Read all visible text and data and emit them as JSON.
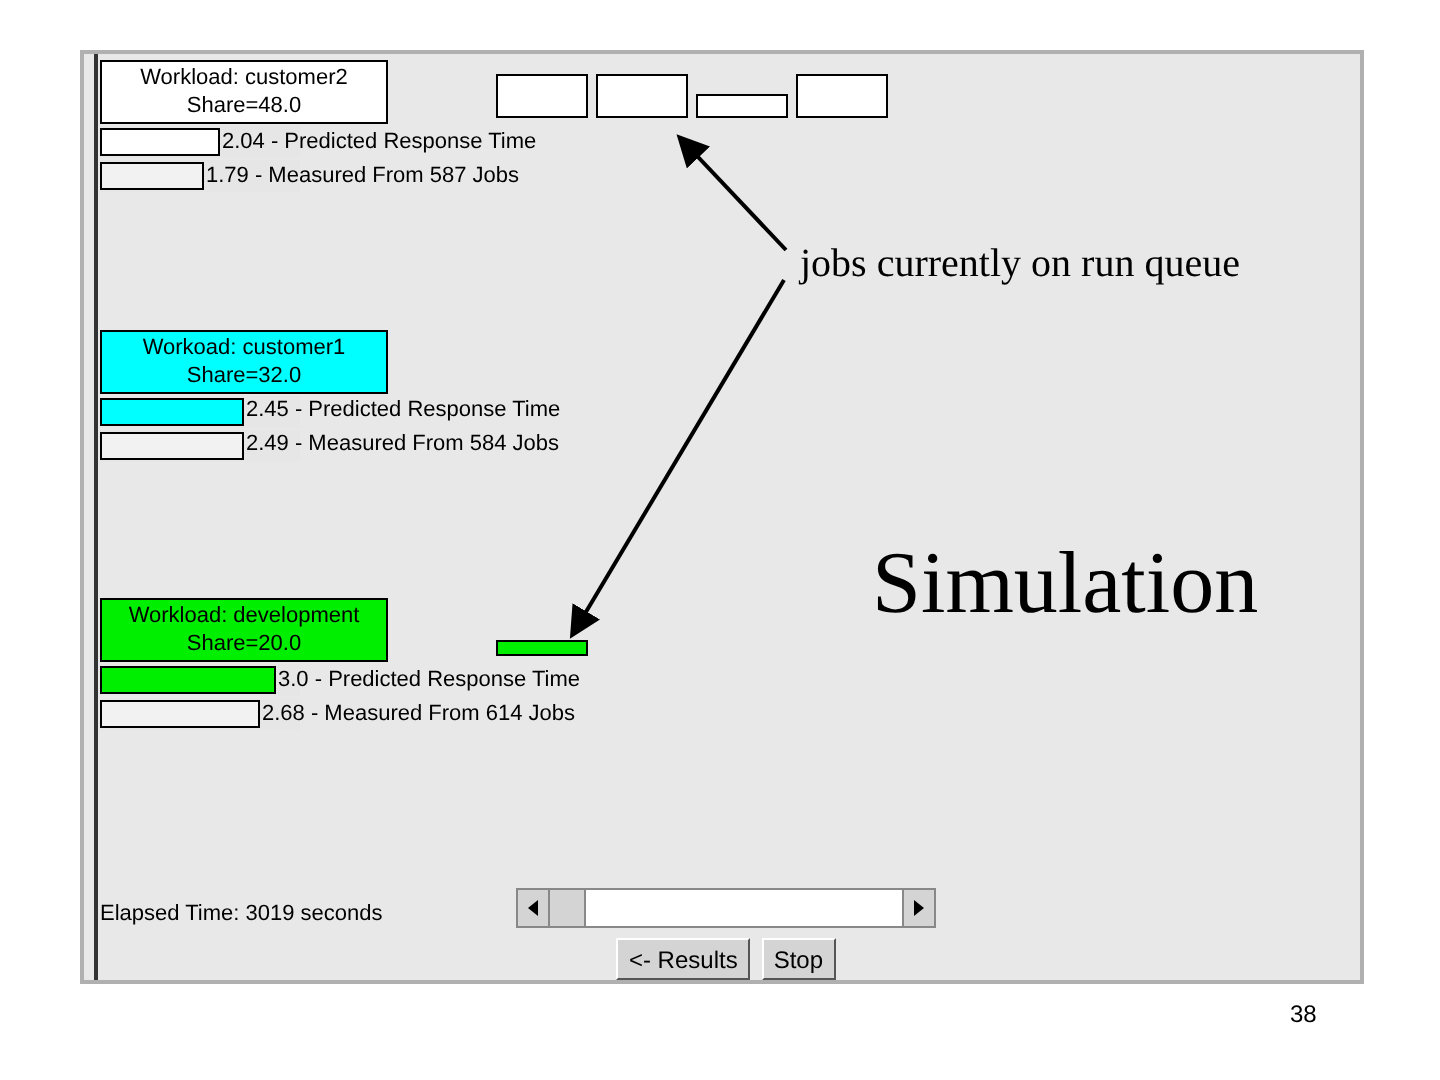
{
  "workloads": [
    {
      "title": "Workload: customer2",
      "share": "Share=48.0",
      "color": "#ffffff",
      "run_queue": [
        {
          "kind": "tall"
        },
        {
          "kind": "tall"
        },
        {
          "kind": "short"
        },
        {
          "kind": "tall"
        }
      ],
      "bars": [
        {
          "kind": "predicted",
          "level": 0.6,
          "text": "2.04 - Predicted Response Time"
        },
        {
          "kind": "measured",
          "level": 0.52,
          "text": "1.79 - Measured From 587 Jobs"
        }
      ]
    },
    {
      "title": "Workoad: customer1",
      "share": "Share=32.0",
      "color": "#00ffff",
      "bars": [
        {
          "kind": "predicted",
          "level": 0.72,
          "text": "2.45 - Predicted Response Time"
        },
        {
          "kind": "measured",
          "level": 0.72,
          "text": "2.49 - Measured From 584 Jobs"
        }
      ]
    },
    {
      "title": "Workload: development",
      "share": "Share=20.0",
      "color": "#00ee00",
      "run_queue": [
        {
          "kind": "thin"
        }
      ],
      "bars": [
        {
          "kind": "predicted",
          "level": 0.88,
          "text": "3.0 - Predicted Response Time"
        },
        {
          "kind": "measured",
          "level": 0.8,
          "text": "2.68 - Measured From 614 Jobs"
        }
      ]
    }
  ],
  "elapsed": "Elapsed Time: 3019 seconds",
  "buttons": [
    "<- Results",
    "Stop"
  ],
  "annotations": {
    "run_queue_note": "jobs currently on run queue",
    "mode": "Simulation"
  },
  "page_number": "38"
}
